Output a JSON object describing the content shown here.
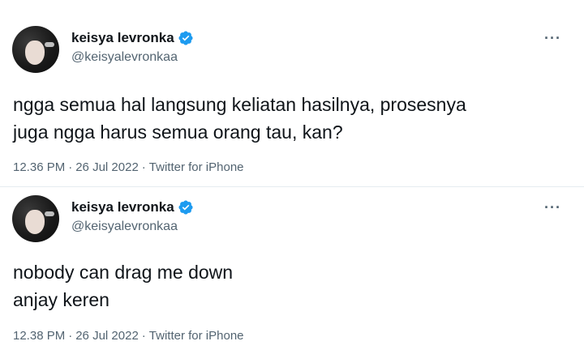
{
  "tweets": [
    {
      "display_name": "keisya levronka",
      "handle": "@keisyalevronkaa",
      "text_lines": [
        "ngga semua hal langsung keliatan hasilnya, prosesnya",
        "juga ngga harus semua orang tau, kan?"
      ],
      "time": "12.36 PM",
      "date": "26 Jul 2022",
      "source": "Twitter for iPhone",
      "separator": "·",
      "more_icon": "more-horizontal-icon",
      "verified_icon": "verified-badge-icon"
    },
    {
      "display_name": "keisya levronka",
      "handle": "@keisyalevronkaa",
      "text_lines": [
        "nobody can drag me down",
        "anjay keren"
      ],
      "time": "12.38 PM",
      "date": "26 Jul 2022",
      "source": "Twitter for iPhone",
      "separator": "·",
      "more_icon": "more-horizontal-icon",
      "verified_icon": "verified-badge-icon"
    }
  ],
  "colors": {
    "text": "#0f1419",
    "secondary": "#536471",
    "verified": "#1d9bf0"
  },
  "more_glyph": "···"
}
